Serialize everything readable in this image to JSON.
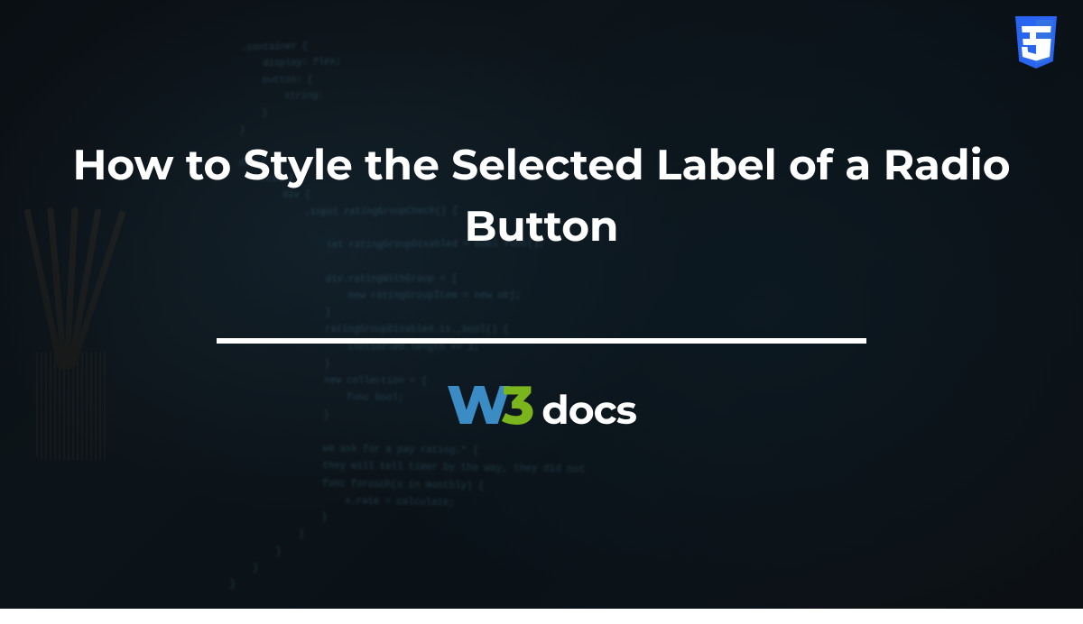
{
  "title": "How to Style the Selected Label of a Radio Button",
  "logo": {
    "part1": "W",
    "part2": "3",
    "part3": "docs"
  },
  "badge": {
    "name": "css3-icon",
    "color": "#2965f1"
  },
  "colors": {
    "logo_blue": "#3b8cc4",
    "logo_green": "#7ab51d",
    "text": "#ffffff"
  }
}
